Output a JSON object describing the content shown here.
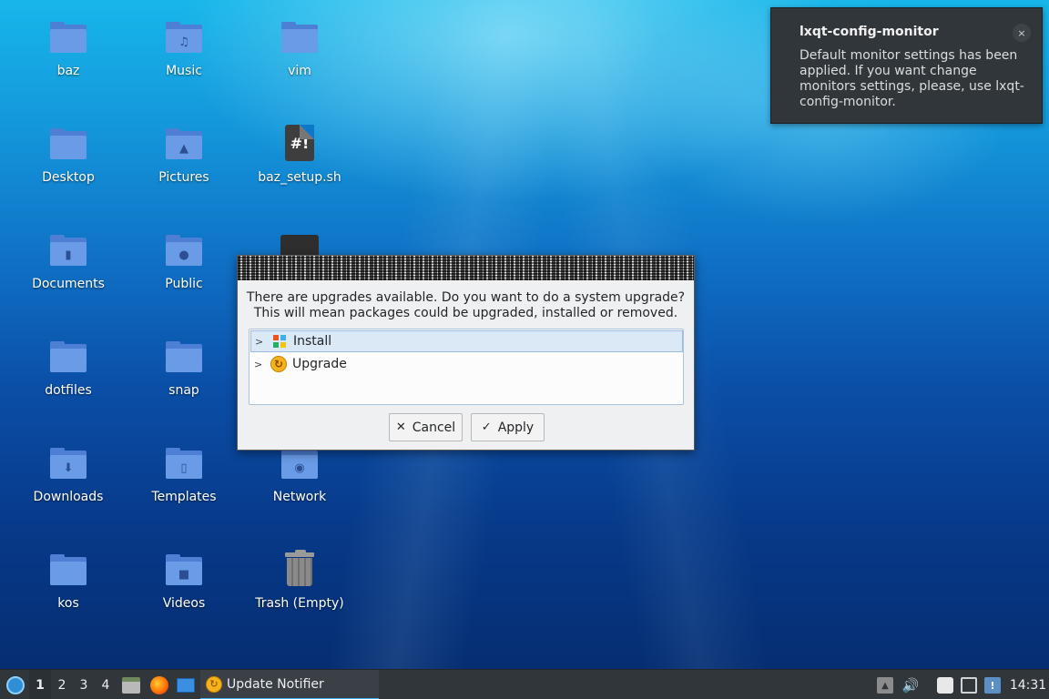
{
  "desktop": {
    "icons": [
      {
        "label": "baz",
        "icon": "folder-icon"
      },
      {
        "label": "Music",
        "icon": "folder-music-icon"
      },
      {
        "label": "vim",
        "icon": "folder-icon"
      },
      {
        "label": "Desktop",
        "icon": "folder-icon"
      },
      {
        "label": "Pictures",
        "icon": "folder-pictures-icon"
      },
      {
        "label": "baz_setup.sh",
        "icon": "shell-script-icon"
      },
      {
        "label": "Documents",
        "icon": "folder-documents-icon"
      },
      {
        "label": "Public",
        "icon": "folder-public-icon"
      },
      {
        "label": "dotfiles",
        "icon": "folder-icon"
      },
      {
        "label": "snap",
        "icon": "folder-icon"
      },
      {
        "label": "Downloads",
        "icon": "folder-downloads-icon"
      },
      {
        "label": "Templates",
        "icon": "folder-templates-icon"
      },
      {
        "label": "Network",
        "icon": "network-icon"
      },
      {
        "label": "kos",
        "icon": "folder-icon"
      },
      {
        "label": "Videos",
        "icon": "folder-videos-icon"
      },
      {
        "label": "Trash (Empty)",
        "icon": "trash-icon"
      }
    ],
    "script_glyph": "#!"
  },
  "notification": {
    "title": "lxqt-config-monitor",
    "body": "Default monitor settings has been applied. If you want change monitors settings, please, use lxqt-config-monitor.",
    "close_glyph": "×"
  },
  "dialog": {
    "message_line1": "There are upgrades available. Do you want to do a system upgrade?",
    "message_line2": "This will mean packages could be upgraded, installed or removed.",
    "tree": [
      {
        "label": "Install",
        "icon": "install-icon",
        "selected": true
      },
      {
        "label": "Upgrade",
        "icon": "upgrade-icon",
        "selected": false
      }
    ],
    "cancel_label": "Cancel",
    "apply_label": "Apply"
  },
  "taskbar": {
    "workspaces": [
      "1",
      "2",
      "3",
      "4"
    ],
    "active_workspace": "1",
    "task_label": "Update Notifier",
    "clock": "14:31"
  },
  "colors": {
    "accent": "#3daee9",
    "panel": "#31363b",
    "folder": "#6a9be6"
  }
}
